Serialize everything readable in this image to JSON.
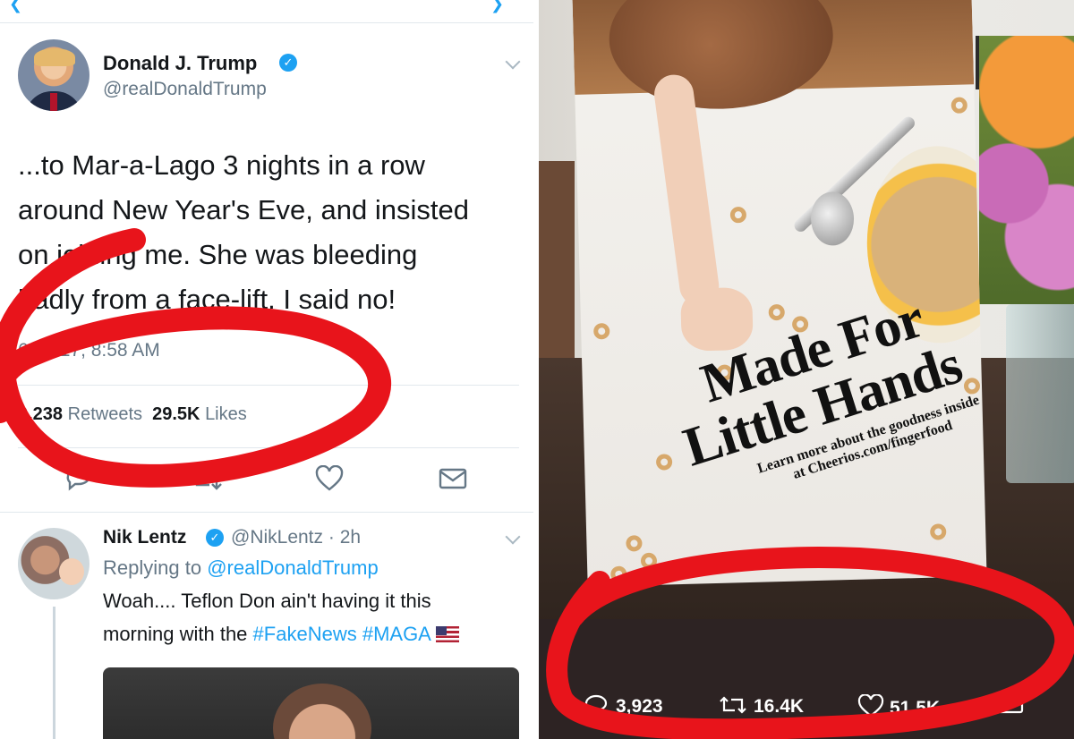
{
  "tweet": {
    "author_name": "Donald J. Trump",
    "author_handle": "@realDonaldTrump",
    "text_lines": [
      "...to Mar-a-Lago 3 nights in a row",
      "around New Year's Eve, and insisted",
      "on joining me. She was bleeding",
      "badly from a face-lift. I said no!"
    ],
    "timestamp": "6/29/17, 8:58 AM",
    "retweets_count": "9,238",
    "retweets_label": "Retweets",
    "likes_count": "29.5K",
    "likes_label": "Likes"
  },
  "reply": {
    "author_name": "Nik Lentz",
    "author_handle": "@NikLentz",
    "time": "· 2h",
    "replying_prefix": "Replying to",
    "replying_to": "@realDonaldTrump",
    "line1": "Woah.... Teflon Don ain't having it this",
    "line2_prefix": "morning with the",
    "hashtag1": "#FakeNews",
    "hashtag2": "#MAGA"
  },
  "photo": {
    "box_title_line1": "Made For",
    "box_title_line2": "Little Hands",
    "box_sub1": "Learn more about the goodness inside",
    "box_sub2": "at Cheerios.com/fingerfood",
    "replies": "3,923",
    "retweets": "16.4K",
    "likes": "51.5K"
  },
  "colors": {
    "link": "#1da1f2",
    "annotation": "#e8141b"
  }
}
